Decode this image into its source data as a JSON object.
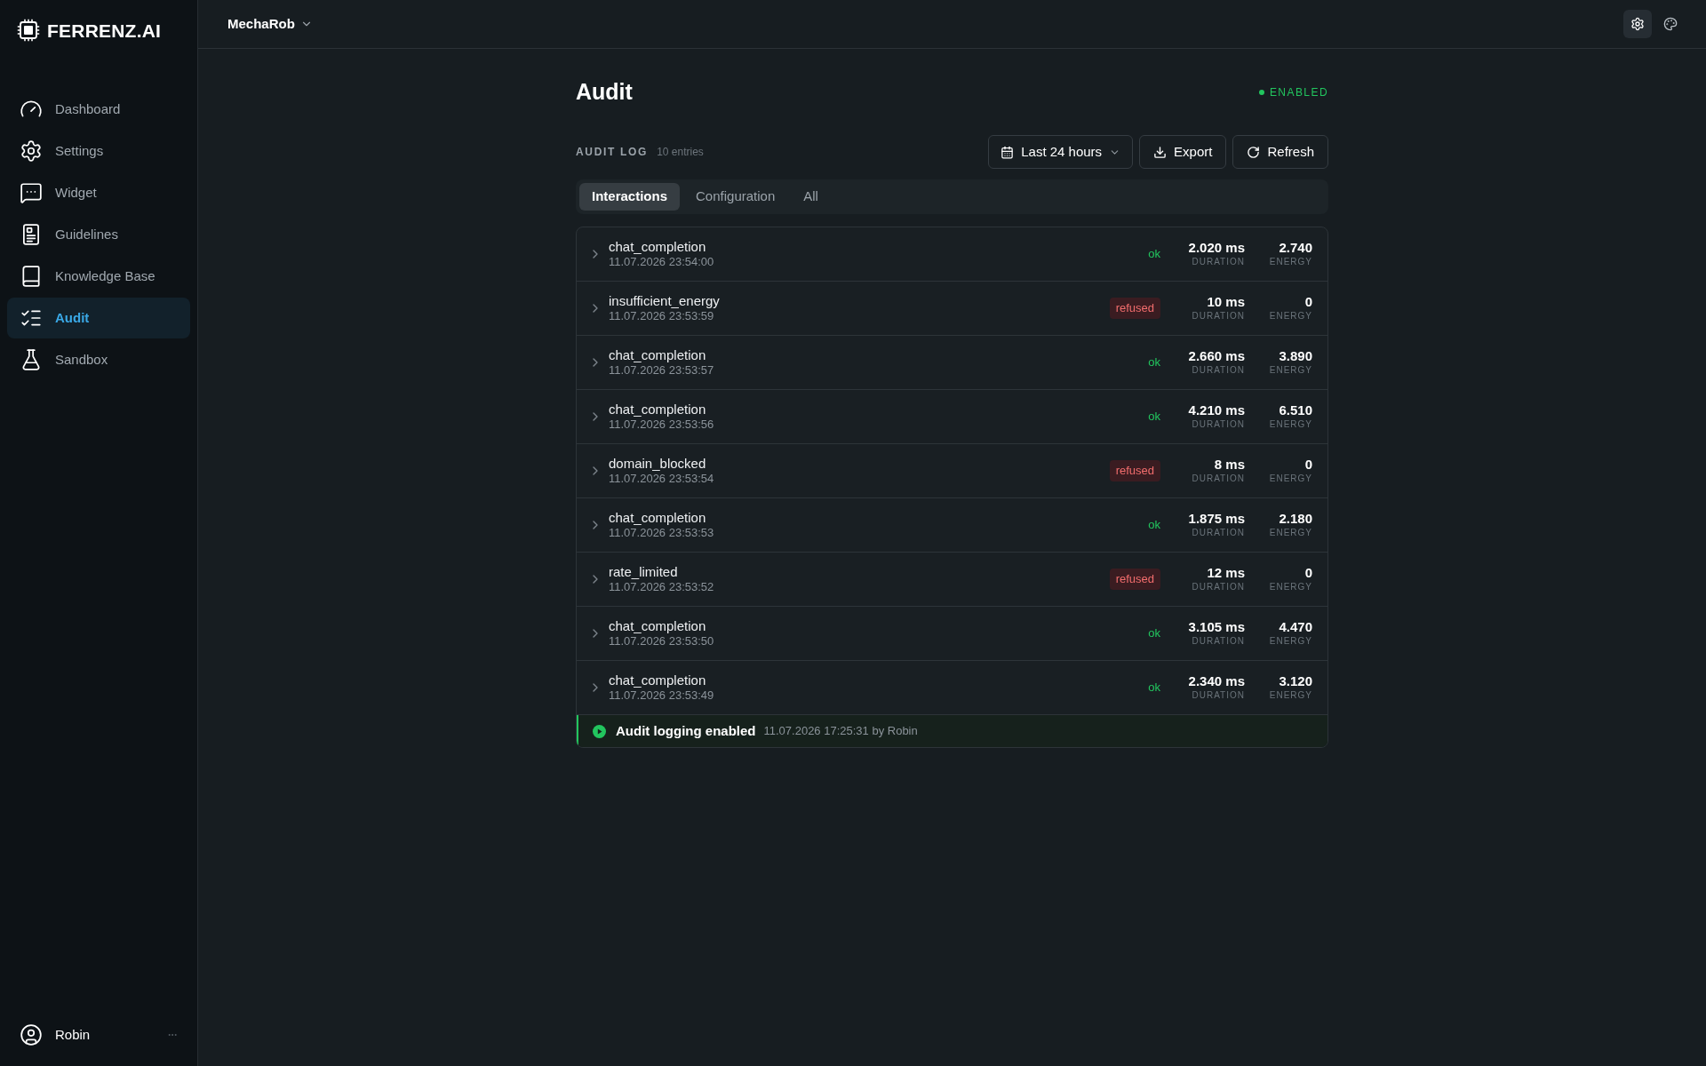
{
  "sidebar": {
    "logo": "FERRENZ.AI",
    "items": [
      {
        "label": "Dashboard",
        "selected": false
      },
      {
        "label": "Settings",
        "selected": false
      },
      {
        "label": "Widget",
        "selected": false
      },
      {
        "label": "Guidelines",
        "selected": false
      },
      {
        "label": "Knowledge Base",
        "selected": false
      },
      {
        "label": "Audit",
        "selected": true
      },
      {
        "label": "Sandbox",
        "selected": false
      }
    ],
    "user": {
      "name": "Robin"
    }
  },
  "topbar": {
    "workspace": "MechaRob",
    "actions": [
      {
        "kind": "settings",
        "selected": true
      },
      {
        "kind": "palette",
        "selected": false
      }
    ]
  },
  "page": {
    "title": "Audit",
    "status": {
      "label": "ENABLED",
      "on": true
    }
  },
  "audit_log": {
    "title": "AUDIT LOG",
    "count": "10 entries",
    "range": "Last 24 hours",
    "buttons": [
      {
        "kind": "export",
        "label": "Export"
      },
      {
        "kind": "refresh",
        "label": "Refresh"
      }
    ],
    "tabs": [
      {
        "label": "Interactions",
        "selected": true
      },
      {
        "label": "Configuration",
        "selected": false
      },
      {
        "label": "All",
        "selected": false
      }
    ],
    "rows": [
      {
        "event": "chat_completion",
        "time": "11.07.2026 23:54:00",
        "status": "ok",
        "kind": "success",
        "duration": "2.020 ms",
        "duration_label": "DURATION",
        "energy": "2.740",
        "energy_label": "ENERGY",
        "expanded": false
      },
      {
        "event": "insufficient_energy",
        "time": "11.07.2026 23:53:59",
        "status": "refused",
        "kind": "error",
        "duration": "10 ms",
        "duration_label": "DURATION",
        "energy": "0",
        "energy_label": "ENERGY",
        "expanded": false
      },
      {
        "event": "chat_completion",
        "time": "11.07.2026 23:53:57",
        "status": "ok",
        "kind": "success",
        "duration": "2.660 ms",
        "duration_label": "DURATION",
        "energy": "3.890",
        "energy_label": "ENERGY",
        "expanded": false
      },
      {
        "event": "chat_completion",
        "time": "11.07.2026 23:53:56",
        "status": "ok",
        "kind": "success",
        "duration": "4.210 ms",
        "duration_label": "DURATION",
        "energy": "6.510",
        "energy_label": "ENERGY",
        "expanded": false
      },
      {
        "event": "domain_blocked",
        "time": "11.07.2026 23:53:54",
        "status": "refused",
        "kind": "error",
        "duration": "8 ms",
        "duration_label": "DURATION",
        "energy": "0",
        "energy_label": "ENERGY",
        "expanded": false
      },
      {
        "event": "chat_completion",
        "time": "11.07.2026 23:53:53",
        "status": "ok",
        "kind": "success",
        "duration": "1.875 ms",
        "duration_label": "DURATION",
        "energy": "2.180",
        "energy_label": "ENERGY",
        "expanded": false
      },
      {
        "event": "rate_limited",
        "time": "11.07.2026 23:53:52",
        "status": "refused",
        "kind": "error",
        "duration": "12 ms",
        "duration_label": "DURATION",
        "energy": "0",
        "energy_label": "ENERGY",
        "expanded": false
      },
      {
        "event": "chat_completion",
        "time": "11.07.2026 23:53:50",
        "status": "ok",
        "kind": "success",
        "duration": "3.105 ms",
        "duration_label": "DURATION",
        "energy": "4.470",
        "energy_label": "ENERGY",
        "expanded": false
      },
      {
        "event": "chat_completion",
        "time": "11.07.2026 23:53:49",
        "status": "ok",
        "kind": "success",
        "duration": "2.340 ms",
        "duration_label": "DURATION",
        "energy": "3.120",
        "energy_label": "ENERGY",
        "expanded": false
      }
    ],
    "footer": {
      "kind": "enabled",
      "event": "Audit logging enabled",
      "meta": "11.07.2026 17:25:31 by Robin"
    }
  }
}
